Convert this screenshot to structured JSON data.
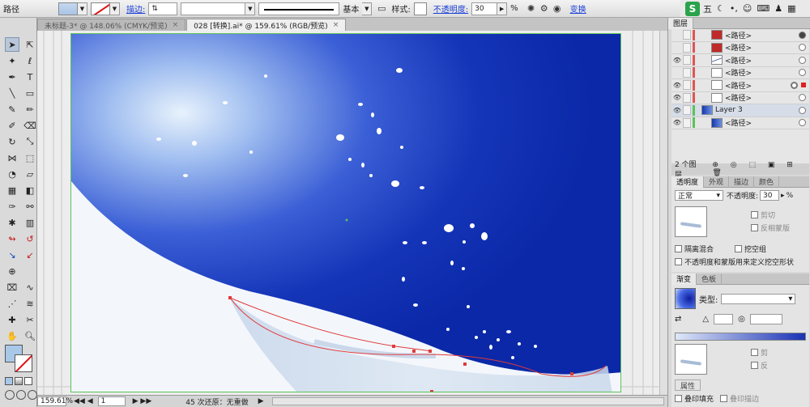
{
  "controlbar": {
    "object_label": "路径",
    "stroke_link": "描边:",
    "stroke_profile": "基本",
    "style_label": "样式:",
    "opacity_link": "不透明度:",
    "opacity_value": "30",
    "opacity_unit": "%",
    "transform_link": "变换"
  },
  "ime": {
    "char1": "五"
  },
  "tabs": [
    {
      "label": "未标题-3* @ 148.06% (CMYK/预览)",
      "close": "×"
    },
    {
      "label": "028 [转换].ai* @ 159.61% (RGB/预览)",
      "close": "×"
    }
  ],
  "status": {
    "zoom": "159.61%",
    "page": "1",
    "undo_text": "45 次还原：无重做"
  },
  "layers_panel": {
    "tab": "图层",
    "rows": [
      {
        "name": "<路径>",
        "thumb": "red",
        "indicator": "filled"
      },
      {
        "name": "<路径>",
        "thumb": "red",
        "indicator": "empty"
      },
      {
        "name": "<路径>",
        "thumb": "line",
        "indicator": "empty"
      },
      {
        "name": "<路径>",
        "thumb": "plain",
        "indicator": "empty"
      },
      {
        "name": "<路径>",
        "thumb": "plain",
        "indicator": "selected"
      },
      {
        "name": "<路径>",
        "thumb": "plain",
        "indicator": "empty"
      },
      {
        "name": "Layer 3",
        "thumb": "blue",
        "indicator": "empty"
      },
      {
        "name": "<路径>",
        "thumb": "blue",
        "indicator": "empty"
      }
    ],
    "footer": "2 个图层"
  },
  "transparency_panel": {
    "tabs": [
      "透明度",
      "外观",
      "描边",
      "颜色"
    ],
    "blend_mode": "正常",
    "opacity_label": "不透明度:",
    "opacity_value": "30",
    "opacity_unit": "%",
    "clip_label": "剪切",
    "invert_mask_label": "反相蒙版",
    "isolate_label": "隔离混合",
    "knockout_label": "挖空组",
    "opacity_mask_label": "不透明度和蒙版用来定义挖空形状"
  },
  "gradient_panel": {
    "tabs": [
      "渐变",
      "色板"
    ],
    "type_label": "类型:",
    "clip_label": "剪",
    "invert_label": "反",
    "overprint_fill": "叠印填充",
    "overprint_stroke": "叠印描边",
    "attr_label": "属性"
  },
  "colors": {
    "accent_blue": "#1637b0",
    "artboard_border": "#5ac35a",
    "path_red": "#e03a3a"
  }
}
